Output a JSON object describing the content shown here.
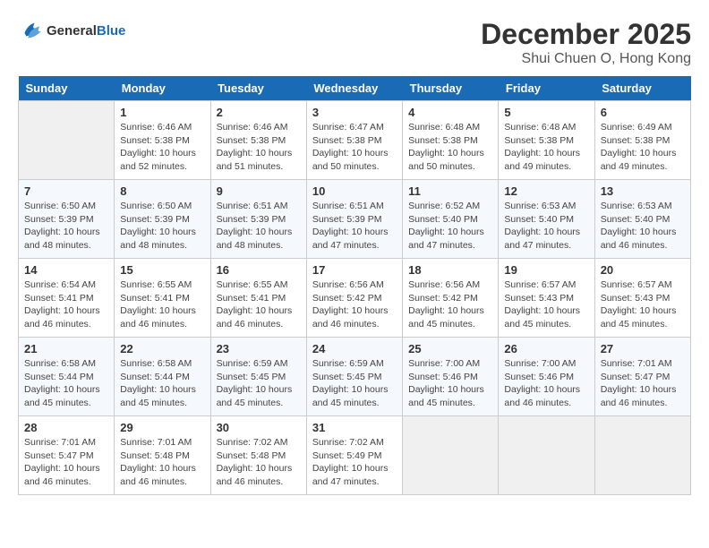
{
  "header": {
    "logo_line1": "General",
    "logo_line2": "Blue",
    "month": "December 2025",
    "location": "Shui Chuen O, Hong Kong"
  },
  "weekdays": [
    "Sunday",
    "Monday",
    "Tuesday",
    "Wednesday",
    "Thursday",
    "Friday",
    "Saturday"
  ],
  "weeks": [
    [
      {
        "day": "",
        "info": ""
      },
      {
        "day": "1",
        "info": "Sunrise: 6:46 AM\nSunset: 5:38 PM\nDaylight: 10 hours\nand 52 minutes."
      },
      {
        "day": "2",
        "info": "Sunrise: 6:46 AM\nSunset: 5:38 PM\nDaylight: 10 hours\nand 51 minutes."
      },
      {
        "day": "3",
        "info": "Sunrise: 6:47 AM\nSunset: 5:38 PM\nDaylight: 10 hours\nand 50 minutes."
      },
      {
        "day": "4",
        "info": "Sunrise: 6:48 AM\nSunset: 5:38 PM\nDaylight: 10 hours\nand 50 minutes."
      },
      {
        "day": "5",
        "info": "Sunrise: 6:48 AM\nSunset: 5:38 PM\nDaylight: 10 hours\nand 49 minutes."
      },
      {
        "day": "6",
        "info": "Sunrise: 6:49 AM\nSunset: 5:38 PM\nDaylight: 10 hours\nand 49 minutes."
      }
    ],
    [
      {
        "day": "7",
        "info": "Sunrise: 6:50 AM\nSunset: 5:39 PM\nDaylight: 10 hours\nand 48 minutes."
      },
      {
        "day": "8",
        "info": "Sunrise: 6:50 AM\nSunset: 5:39 PM\nDaylight: 10 hours\nand 48 minutes."
      },
      {
        "day": "9",
        "info": "Sunrise: 6:51 AM\nSunset: 5:39 PM\nDaylight: 10 hours\nand 48 minutes."
      },
      {
        "day": "10",
        "info": "Sunrise: 6:51 AM\nSunset: 5:39 PM\nDaylight: 10 hours\nand 47 minutes."
      },
      {
        "day": "11",
        "info": "Sunrise: 6:52 AM\nSunset: 5:40 PM\nDaylight: 10 hours\nand 47 minutes."
      },
      {
        "day": "12",
        "info": "Sunrise: 6:53 AM\nSunset: 5:40 PM\nDaylight: 10 hours\nand 47 minutes."
      },
      {
        "day": "13",
        "info": "Sunrise: 6:53 AM\nSunset: 5:40 PM\nDaylight: 10 hours\nand 46 minutes."
      }
    ],
    [
      {
        "day": "14",
        "info": "Sunrise: 6:54 AM\nSunset: 5:41 PM\nDaylight: 10 hours\nand 46 minutes."
      },
      {
        "day": "15",
        "info": "Sunrise: 6:55 AM\nSunset: 5:41 PM\nDaylight: 10 hours\nand 46 minutes."
      },
      {
        "day": "16",
        "info": "Sunrise: 6:55 AM\nSunset: 5:41 PM\nDaylight: 10 hours\nand 46 minutes."
      },
      {
        "day": "17",
        "info": "Sunrise: 6:56 AM\nSunset: 5:42 PM\nDaylight: 10 hours\nand 46 minutes."
      },
      {
        "day": "18",
        "info": "Sunrise: 6:56 AM\nSunset: 5:42 PM\nDaylight: 10 hours\nand 45 minutes."
      },
      {
        "day": "19",
        "info": "Sunrise: 6:57 AM\nSunset: 5:43 PM\nDaylight: 10 hours\nand 45 minutes."
      },
      {
        "day": "20",
        "info": "Sunrise: 6:57 AM\nSunset: 5:43 PM\nDaylight: 10 hours\nand 45 minutes."
      }
    ],
    [
      {
        "day": "21",
        "info": "Sunrise: 6:58 AM\nSunset: 5:44 PM\nDaylight: 10 hours\nand 45 minutes."
      },
      {
        "day": "22",
        "info": "Sunrise: 6:58 AM\nSunset: 5:44 PM\nDaylight: 10 hours\nand 45 minutes."
      },
      {
        "day": "23",
        "info": "Sunrise: 6:59 AM\nSunset: 5:45 PM\nDaylight: 10 hours\nand 45 minutes."
      },
      {
        "day": "24",
        "info": "Sunrise: 6:59 AM\nSunset: 5:45 PM\nDaylight: 10 hours\nand 45 minutes."
      },
      {
        "day": "25",
        "info": "Sunrise: 7:00 AM\nSunset: 5:46 PM\nDaylight: 10 hours\nand 45 minutes."
      },
      {
        "day": "26",
        "info": "Sunrise: 7:00 AM\nSunset: 5:46 PM\nDaylight: 10 hours\nand 46 minutes."
      },
      {
        "day": "27",
        "info": "Sunrise: 7:01 AM\nSunset: 5:47 PM\nDaylight: 10 hours\nand 46 minutes."
      }
    ],
    [
      {
        "day": "28",
        "info": "Sunrise: 7:01 AM\nSunset: 5:47 PM\nDaylight: 10 hours\nand 46 minutes."
      },
      {
        "day": "29",
        "info": "Sunrise: 7:01 AM\nSunset: 5:48 PM\nDaylight: 10 hours\nand 46 minutes."
      },
      {
        "day": "30",
        "info": "Sunrise: 7:02 AM\nSunset: 5:48 PM\nDaylight: 10 hours\nand 46 minutes."
      },
      {
        "day": "31",
        "info": "Sunrise: 7:02 AM\nSunset: 5:49 PM\nDaylight: 10 hours\nand 47 minutes."
      },
      {
        "day": "",
        "info": ""
      },
      {
        "day": "",
        "info": ""
      },
      {
        "day": "",
        "info": ""
      }
    ]
  ]
}
